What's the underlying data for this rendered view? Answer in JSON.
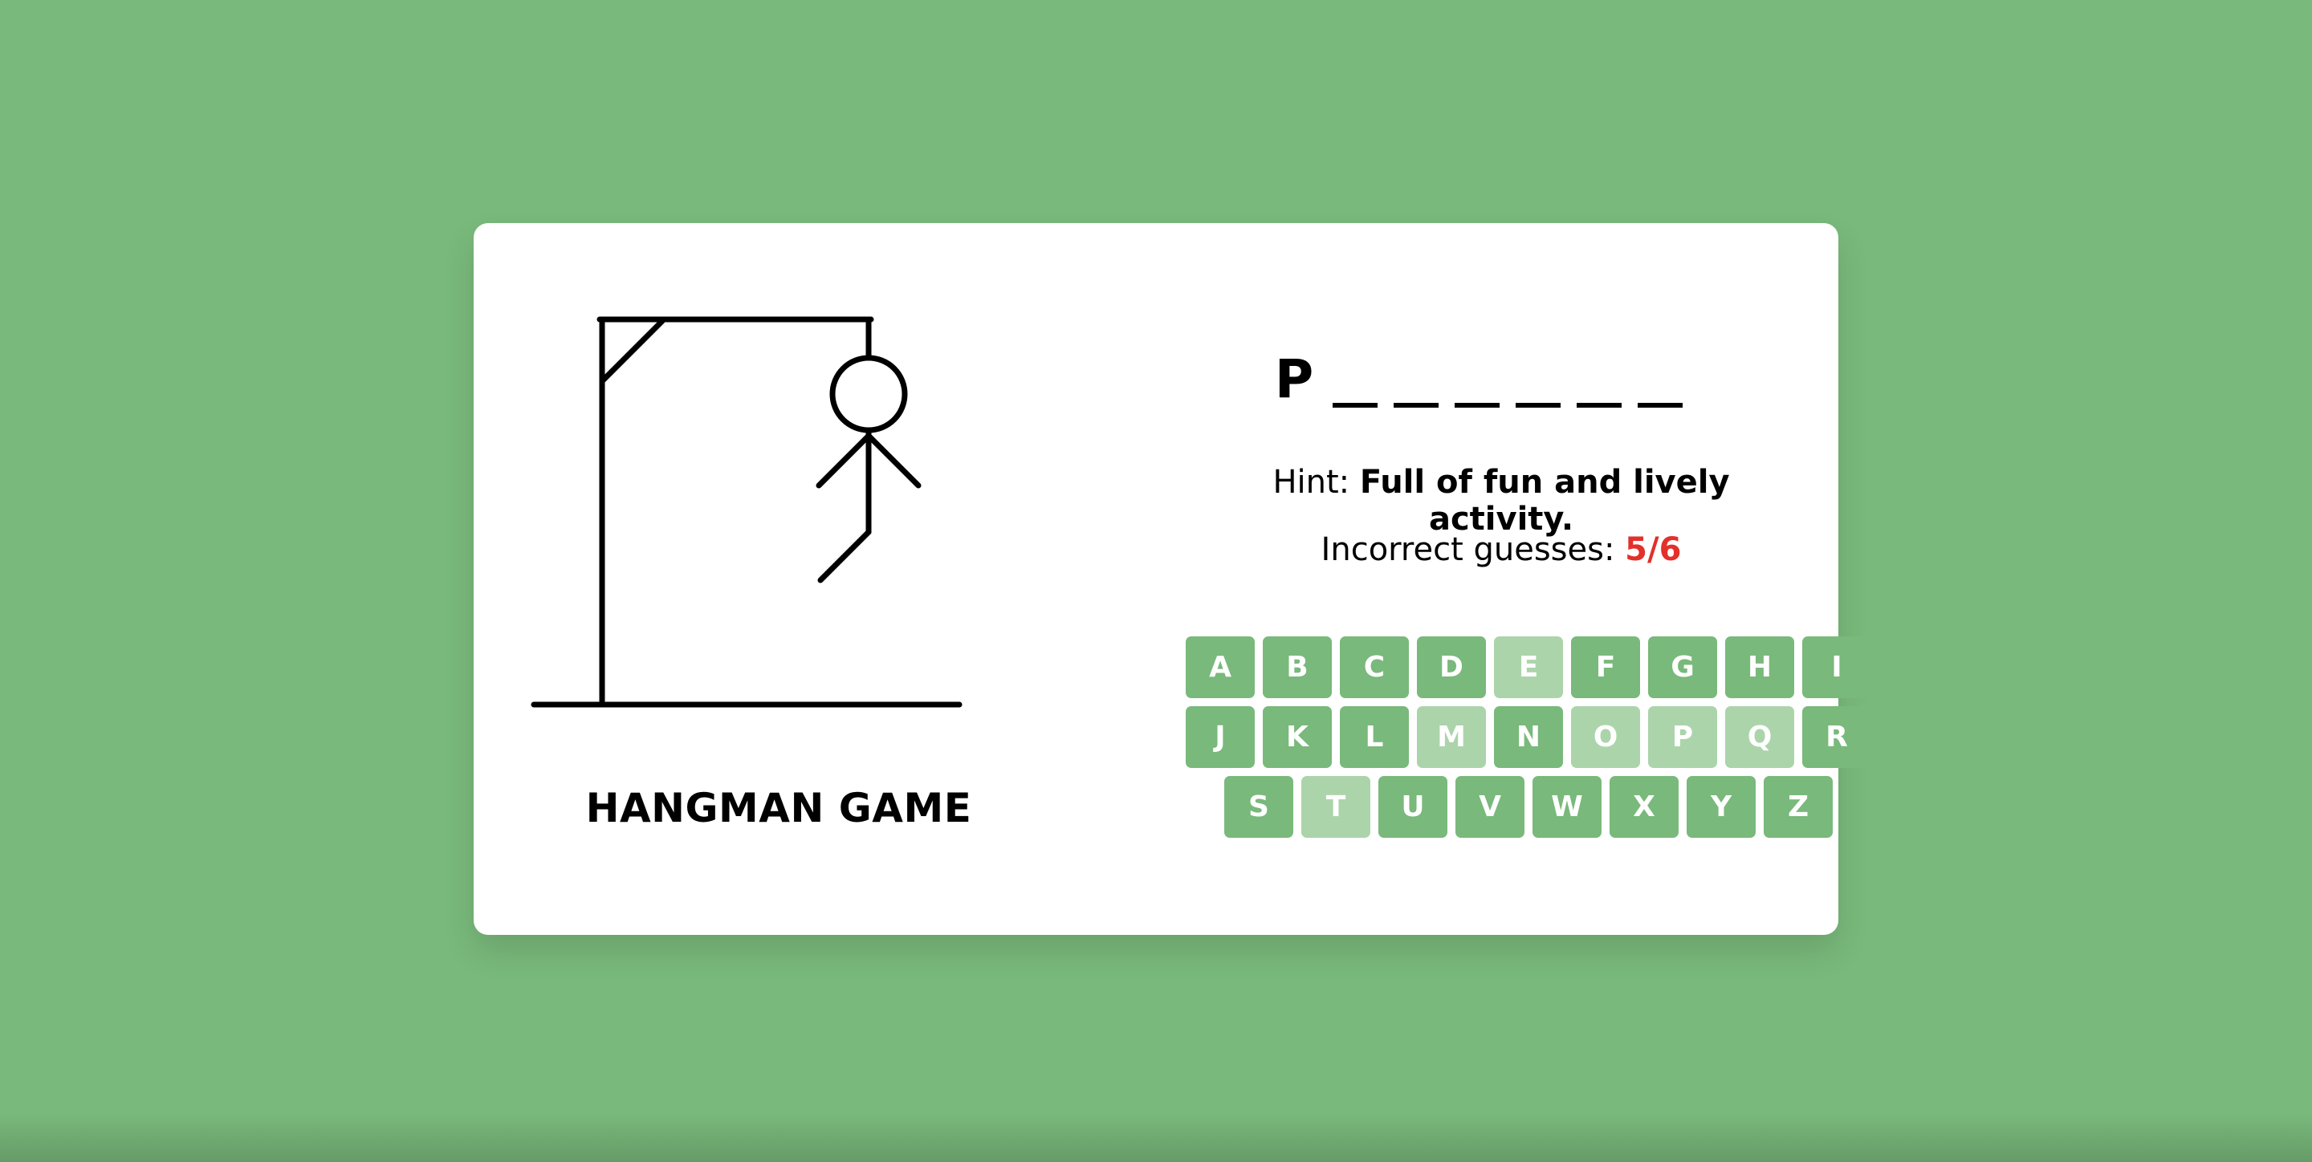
{
  "game": {
    "title": "HANGMAN GAME",
    "word_slots": [
      "P",
      "",
      "",
      "",
      "",
      "",
      ""
    ],
    "hint_label": "Hint:",
    "hint_text": "Full of fun and lively activity.",
    "guesses_label": "Incorrect guesses:",
    "guesses_count": "5/6",
    "incorrect_guesses": 5,
    "max_guesses": 6
  },
  "keyboard": {
    "rows": [
      [
        {
          "letter": "A",
          "used": false
        },
        {
          "letter": "B",
          "used": false
        },
        {
          "letter": "C",
          "used": false
        },
        {
          "letter": "D",
          "used": false
        },
        {
          "letter": "E",
          "used": true
        },
        {
          "letter": "F",
          "used": false
        },
        {
          "letter": "G",
          "used": false
        },
        {
          "letter": "H",
          "used": false
        },
        {
          "letter": "I",
          "used": false
        }
      ],
      [
        {
          "letter": "J",
          "used": false
        },
        {
          "letter": "K",
          "used": false
        },
        {
          "letter": "L",
          "used": false
        },
        {
          "letter": "M",
          "used": true
        },
        {
          "letter": "N",
          "used": false
        },
        {
          "letter": "O",
          "used": true
        },
        {
          "letter": "P",
          "used": true
        },
        {
          "letter": "Q",
          "used": true
        },
        {
          "letter": "R",
          "used": false
        }
      ],
      [
        {
          "letter": "S",
          "used": false
        },
        {
          "letter": "T",
          "used": true
        },
        {
          "letter": "U",
          "used": false
        },
        {
          "letter": "V",
          "used": false
        },
        {
          "letter": "W",
          "used": false
        },
        {
          "letter": "X",
          "used": false
        },
        {
          "letter": "Y",
          "used": false
        },
        {
          "letter": "Z",
          "used": false
        }
      ]
    ]
  },
  "colors": {
    "background": "#79b97b",
    "key": "#79b97b",
    "key_used": "#abd4ab",
    "guess_count": "#e3302a"
  }
}
